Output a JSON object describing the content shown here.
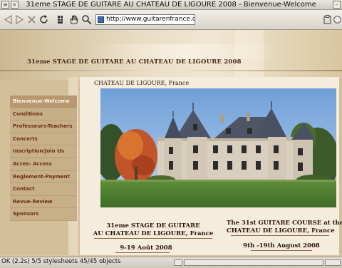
{
  "window": {
    "title": "31eme STAGE DE GUITARE AU CHATEAU DE LIGOURE 2008 - Bienvenue-Welcome"
  },
  "toolbar": {
    "url": "http://www.guitarenfrance.org/"
  },
  "header": {
    "site_title": "31eme STAGE DE GUITARE AU CHATEAU DE LIGOURE 2008",
    "caption": "CHATEAU DE LIGOURE, France"
  },
  "sidebar": {
    "items": [
      {
        "label": "Bienvenue-Welcome"
      },
      {
        "label": "Conditions"
      },
      {
        "label": "Professeurs-Teachers"
      },
      {
        "label": "Concerts"
      },
      {
        "label": "Inscription/Join Us"
      },
      {
        "label": "Acces- Access"
      },
      {
        "label": "Reglement-Payment"
      },
      {
        "label": "Contact"
      },
      {
        "label": "Revue-Review"
      },
      {
        "label": "Sponsors"
      }
    ]
  },
  "footer": {
    "fr_line1": "31eme STAGE DE GUITARE",
    "fr_line2": "AU CHATEAU DE LIGOURE, France",
    "fr_dates": "9-19 Août  2008",
    "en_line1": "The 31st GUITARE COURSE at the",
    "en_line2": "CHATEAU DE LIGOURE, France",
    "en_dates": "9th -19th August 2008"
  },
  "status": {
    "text": "OK (2.2s) 5/5 stylesheets 45/45 objects"
  },
  "colors": {
    "nav_text": "#6b2c18",
    "nav_active_bg": "#b79870",
    "page_bg": "#d3bf98"
  }
}
